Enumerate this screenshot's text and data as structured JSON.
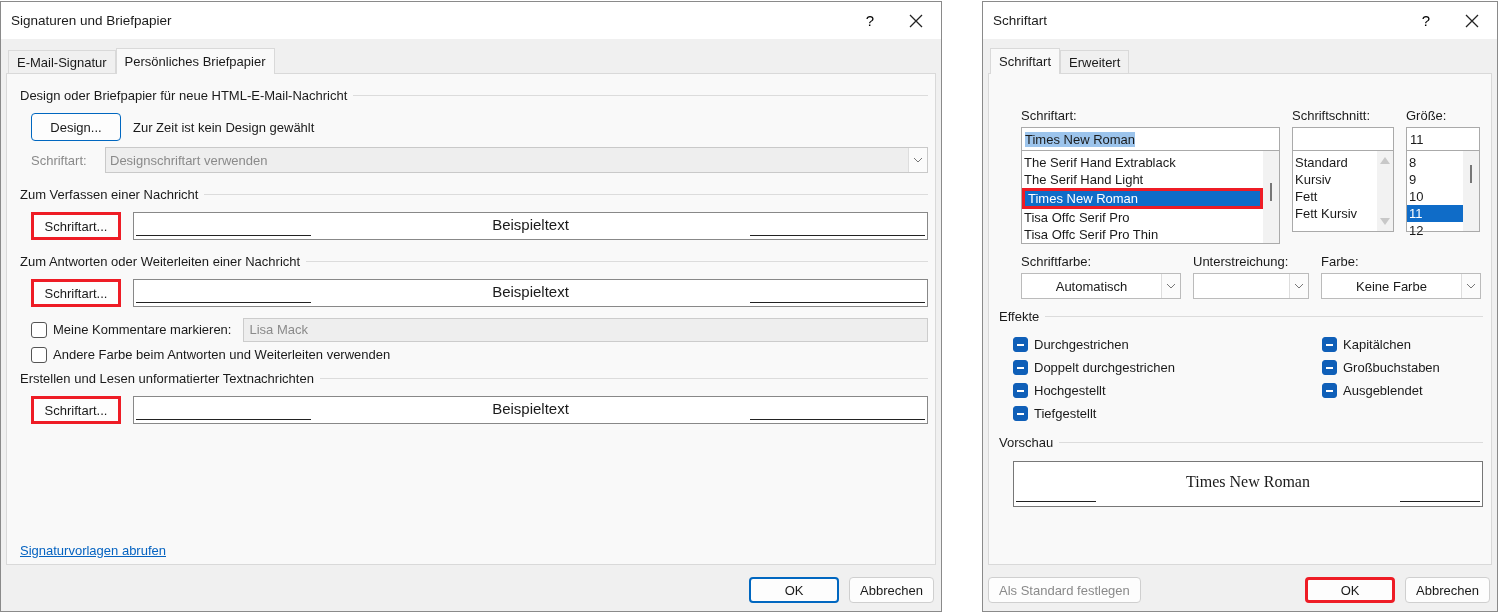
{
  "signatures_dialog": {
    "title": "Signaturen und Briefpapier",
    "help_button": "?",
    "tabs": [
      {
        "label": "E-Mail-Signatur",
        "selected": false
      },
      {
        "label": "Persönliches Briefpapier",
        "selected": true
      }
    ],
    "design_group": {
      "heading": "Design oder Briefpapier für neue HTML-E-Mail-Nachricht",
      "design_button": "Design...",
      "status": "Zur Zeit ist kein Design gewählt",
      "font_label": "Schriftart:",
      "font_select": {
        "value": "Designschriftart verwenden",
        "disabled": true
      }
    },
    "font_groups": [
      {
        "heading": "Zum Verfassen einer Nachricht",
        "button": {
          "label": "Schriftart...",
          "highlighted": true
        },
        "sample": "Beispieltext"
      },
      {
        "heading": "Zum Antworten oder Weiterleiten einer Nachricht",
        "button": {
          "label": "Schriftart...",
          "highlighted": true
        },
        "sample": "Beispieltext",
        "options": [
          {
            "label": "Meine Kommentare markieren:",
            "checked": false,
            "field": {
              "value": "Lisa Mack",
              "disabled": true
            }
          },
          {
            "label": "Andere Farbe beim Antworten und Weiterleiten verwenden",
            "checked": false
          }
        ]
      },
      {
        "heading": "Erstellen und Lesen unformatierter Textnachrichten",
        "button": {
          "label": "Schriftart...",
          "highlighted": true
        },
        "sample": "Beispieltext"
      }
    ],
    "link": "Signaturvorlagen abrufen",
    "buttons": [
      {
        "label": "OK",
        "default": true
      },
      {
        "label": "Abbrechen",
        "default": false
      }
    ]
  },
  "font_dialog": {
    "title": "Schriftart",
    "help_button": "?",
    "tabs": [
      {
        "label": "Schriftart",
        "selected": true
      },
      {
        "label": "Erweitert",
        "selected": false
      }
    ],
    "font": {
      "label": "Schriftart:",
      "value": "Times New Roman",
      "items": [
        {
          "label": "The Serif Hand Extrablack",
          "selected": false,
          "highlighted": false
        },
        {
          "label": "The Serif Hand Light",
          "selected": false,
          "highlighted": false
        },
        {
          "label": "Times New Roman",
          "selected": true,
          "highlighted": true
        },
        {
          "label": "Tisa Offc Serif Pro",
          "selected": false,
          "highlighted": false
        },
        {
          "label": "Tisa Offc Serif Pro Thin",
          "selected": false,
          "highlighted": false
        }
      ]
    },
    "style": {
      "label": "Schriftschnitt:",
      "items": [
        {
          "label": "Standard",
          "selected": false
        },
        {
          "label": "Kursiv",
          "selected": false
        },
        {
          "label": "Fett",
          "selected": false
        },
        {
          "label": "Fett Kursiv",
          "selected": false
        }
      ]
    },
    "size": {
      "label": "Größe:",
      "value": "11",
      "items": [
        {
          "label": "8",
          "selected": false
        },
        {
          "label": "9",
          "selected": false
        },
        {
          "label": "10",
          "selected": false
        },
        {
          "label": "11",
          "selected": true
        },
        {
          "label": "12",
          "selected": false
        }
      ]
    },
    "dropdowns": [
      {
        "label": "Schriftfarbe:",
        "value": "Automatisch"
      },
      {
        "label": "Unterstreichung:"
      },
      {
        "label": "Farbe:",
        "value": "Keine Farbe"
      }
    ],
    "effects_heading": "Effekte",
    "effects_columns": [
      [
        {
          "label": "Durchgestrichen",
          "indeterminate": true
        },
        {
          "label": "Doppelt durchgestrichen",
          "indeterminate": true
        },
        {
          "label": "Hochgestellt",
          "indeterminate": true
        },
        {
          "label": "Tiefgestellt",
          "indeterminate": true
        }
      ],
      [
        {
          "label": "Kapitälchen",
          "indeterminate": true
        },
        {
          "label": "Großbuchstaben",
          "indeterminate": true
        },
        {
          "label": "Ausgeblendet",
          "indeterminate": true
        }
      ]
    ],
    "preview_heading": "Vorschau",
    "preview_text": "Times New Roman",
    "buttons": [
      {
        "label": "Als Standard festlegen",
        "disabled": true,
        "highlighted": false
      },
      {
        "label": "OK",
        "disabled": false,
        "highlighted": true
      },
      {
        "label": "Abbrechen",
        "disabled": false,
        "highlighted": false
      }
    ]
  }
}
